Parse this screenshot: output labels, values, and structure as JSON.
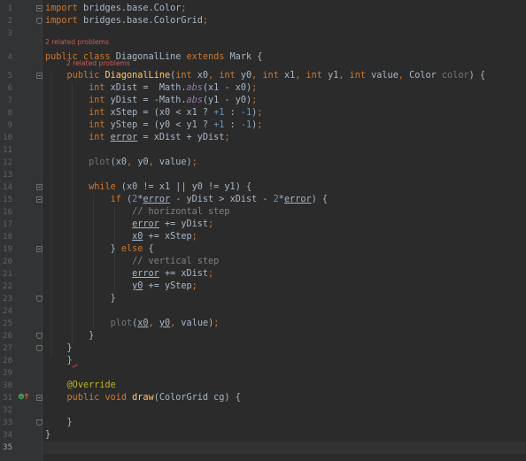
{
  "editor": {
    "problem_hints": [
      "2 related problems",
      "2 related problems"
    ],
    "lines": [
      {
        "n": "1",
        "t": [
          {
            "c": "kw",
            "v": "import"
          },
          {
            "v": " bridges.base.Color"
          },
          {
            "c": "kw",
            "v": ";"
          }
        ]
      },
      {
        "n": "2",
        "t": [
          {
            "c": "kw",
            "v": "import"
          },
          {
            "v": " bridges.base.ColorGrid"
          },
          {
            "c": "kw",
            "v": ";"
          }
        ]
      },
      {
        "n": "3",
        "t": []
      },
      {
        "n": "4",
        "t": [
          {
            "c": "kw",
            "v": "public class "
          },
          {
            "v": "DiagonalLine "
          },
          {
            "c": "kw",
            "v": "extends "
          },
          {
            "v": "Mark {"
          }
        ]
      },
      {
        "n": "5",
        "t": [
          {
            "v": "    "
          },
          {
            "c": "kw",
            "v": "public "
          },
          {
            "c": "fn",
            "v": "DiagonalLine"
          },
          {
            "v": "("
          },
          {
            "c": "kw",
            "v": "int "
          },
          {
            "v": "x0"
          },
          {
            "c": "kw",
            "v": ", int "
          },
          {
            "v": "y0"
          },
          {
            "c": "kw",
            "v": ", int "
          },
          {
            "v": "x1"
          },
          {
            "c": "kw",
            "v": ", int "
          },
          {
            "v": "y1"
          },
          {
            "c": "kw",
            "v": ", int "
          },
          {
            "v": "value"
          },
          {
            "c": "kw",
            "v": ", "
          },
          {
            "v": "Color "
          },
          {
            "c": "pa",
            "v": "color"
          },
          {
            "v": ") {"
          }
        ]
      },
      {
        "n": "6",
        "t": [
          {
            "v": "        "
          },
          {
            "c": "kw",
            "v": "int "
          },
          {
            "v": "xDist =  Math."
          },
          {
            "c": "st",
            "v": "abs"
          },
          {
            "v": "(x1 - x0)"
          },
          {
            "c": "kw",
            "v": ";"
          }
        ]
      },
      {
        "n": "7",
        "t": [
          {
            "v": "        "
          },
          {
            "c": "kw",
            "v": "int "
          },
          {
            "v": "yDist = -Math."
          },
          {
            "c": "st",
            "v": "abs"
          },
          {
            "v": "(y1 - y0)"
          },
          {
            "c": "kw",
            "v": ";"
          }
        ]
      },
      {
        "n": "8",
        "t": [
          {
            "v": "        "
          },
          {
            "c": "kw",
            "v": "int "
          },
          {
            "v": "xStep = (x0 < x1 ? "
          },
          {
            "c": "nu",
            "v": "+1"
          },
          {
            "v": " : "
          },
          {
            "c": "nu",
            "v": "-1"
          },
          {
            "v": ")"
          },
          {
            "c": "kw",
            "v": ";"
          }
        ]
      },
      {
        "n": "9",
        "t": [
          {
            "v": "        "
          },
          {
            "c": "kw",
            "v": "int "
          },
          {
            "v": "yStep = (y0 < y1 ? "
          },
          {
            "c": "nu",
            "v": "+1"
          },
          {
            "v": " : "
          },
          {
            "c": "nu",
            "v": "-1"
          },
          {
            "v": ")"
          },
          {
            "c": "kw",
            "v": ";"
          }
        ]
      },
      {
        "n": "10",
        "t": [
          {
            "v": "        "
          },
          {
            "c": "kw",
            "v": "int "
          },
          {
            "c": "ul",
            "v": "error"
          },
          {
            "v": " = xDist + yDist"
          },
          {
            "c": "kw",
            "v": ";"
          }
        ]
      },
      {
        "n": "11",
        "t": []
      },
      {
        "n": "12",
        "t": [
          {
            "v": "        "
          },
          {
            "c": "pa",
            "v": "plot"
          },
          {
            "v": "(x0"
          },
          {
            "c": "kw",
            "v": ", "
          },
          {
            "v": "y0"
          },
          {
            "c": "kw",
            "v": ", "
          },
          {
            "v": "value)"
          },
          {
            "c": "kw",
            "v": ";"
          }
        ]
      },
      {
        "n": "13",
        "t": []
      },
      {
        "n": "14",
        "t": [
          {
            "v": "        "
          },
          {
            "c": "kw",
            "v": "while "
          },
          {
            "v": "(x0 != x1 || y0 != y1) {"
          }
        ]
      },
      {
        "n": "15",
        "t": [
          {
            "v": "            "
          },
          {
            "c": "kw",
            "v": "if "
          },
          {
            "v": "("
          },
          {
            "c": "nu",
            "v": "2"
          },
          {
            "v": "*"
          },
          {
            "c": "ul",
            "v": "error"
          },
          {
            "v": " - yDist > xDist - "
          },
          {
            "c": "nu",
            "v": "2"
          },
          {
            "v": "*"
          },
          {
            "c": "ul",
            "v": "error"
          },
          {
            "v": ") {"
          }
        ]
      },
      {
        "n": "16",
        "t": [
          {
            "v": "                "
          },
          {
            "c": "cm",
            "v": "// horizontal step"
          }
        ]
      },
      {
        "n": "17",
        "t": [
          {
            "v": "                "
          },
          {
            "c": "ul",
            "v": "error"
          },
          {
            "v": " += yDist"
          },
          {
            "c": "kw",
            "v": ";"
          }
        ]
      },
      {
        "n": "18",
        "t": [
          {
            "v": "                "
          },
          {
            "c": "ul",
            "v": "x0"
          },
          {
            "v": " += xStep"
          },
          {
            "c": "kw",
            "v": ";"
          }
        ]
      },
      {
        "n": "19",
        "t": [
          {
            "v": "            } "
          },
          {
            "c": "kw",
            "v": "else "
          },
          {
            "v": "{"
          }
        ]
      },
      {
        "n": "20",
        "t": [
          {
            "v": "                "
          },
          {
            "c": "cm",
            "v": "// vertical step"
          }
        ]
      },
      {
        "n": "21",
        "t": [
          {
            "v": "                "
          },
          {
            "c": "ul",
            "v": "error"
          },
          {
            "v": " += xDist"
          },
          {
            "c": "kw",
            "v": ";"
          }
        ]
      },
      {
        "n": "22",
        "t": [
          {
            "v": "                "
          },
          {
            "c": "ul",
            "v": "y0"
          },
          {
            "v": " += yStep"
          },
          {
            "c": "kw",
            "v": ";"
          }
        ]
      },
      {
        "n": "23",
        "t": [
          {
            "v": "            }"
          }
        ]
      },
      {
        "n": "24",
        "t": []
      },
      {
        "n": "25",
        "t": [
          {
            "v": "            "
          },
          {
            "c": "pa",
            "v": "plot"
          },
          {
            "v": "("
          },
          {
            "c": "ul",
            "v": "x0"
          },
          {
            "c": "kw",
            "v": ", "
          },
          {
            "c": "ul",
            "v": "y0"
          },
          {
            "c": "kw",
            "v": ", "
          },
          {
            "v": "value)"
          },
          {
            "c": "kw",
            "v": ";"
          }
        ]
      },
      {
        "n": "26",
        "t": [
          {
            "v": "        }"
          }
        ]
      },
      {
        "n": "27",
        "t": [
          {
            "v": "    }"
          }
        ]
      },
      {
        "n": "28",
        "t": [
          {
            "v": "    }"
          },
          {
            "c": "wv",
            "v": " "
          }
        ]
      },
      {
        "n": "29",
        "t": []
      },
      {
        "n": "30",
        "t": [
          {
            "v": "    "
          },
          {
            "c": "an",
            "v": "@Override"
          }
        ]
      },
      {
        "n": "31",
        "t": [
          {
            "v": "    "
          },
          {
            "c": "kw",
            "v": "public void "
          },
          {
            "c": "fn",
            "v": "draw"
          },
          {
            "v": "(ColorGrid cg) {"
          }
        ]
      },
      {
        "n": "32",
        "t": []
      },
      {
        "n": "33",
        "t": [
          {
            "v": "    }"
          }
        ]
      },
      {
        "n": "34",
        "t": [
          {
            "v": "}"
          }
        ]
      },
      {
        "n": "35",
        "t": []
      }
    ],
    "active_line": "35",
    "colors": {
      "background": "#2b2b2b",
      "gutter": "#313335",
      "keyword": "#cc7832",
      "method": "#ffc66d",
      "number": "#6897bb",
      "comment": "#808080",
      "annotation": "#bbb529",
      "error_hint": "#cf5b56"
    },
    "gutter_icons": {
      "line_31": "override-method-icon"
    }
  }
}
